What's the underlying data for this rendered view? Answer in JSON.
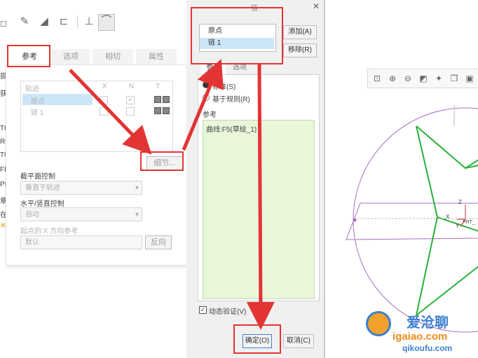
{
  "left_panel": {
    "tabs": [
      "参考",
      "选项",
      "相切",
      "属性"
    ],
    "table": {
      "headers": [
        "轨迹",
        "X",
        "N",
        "T"
      ],
      "rows": [
        {
          "name": "原点"
        },
        {
          "name": "链 1"
        }
      ]
    },
    "details_button": "细节...",
    "section_plane_label": "截平面控制",
    "section_plane_value": "垂直于轨迹",
    "hv_label": "水平/竖直控制",
    "hv_value": "自动",
    "xdir_label": "起点的 X 方向参考",
    "xdir_value": "默认",
    "reverse_button": "反向",
    "left_edge_chars": [
      "扱",
      "获",
      "T0",
      "R0",
      "T0",
      "FF",
      "PI",
      "章",
      "在",
      "※"
    ]
  },
  "chain_dialog": {
    "title_fragment": "链",
    "list_items": [
      "原点",
      "链 1"
    ],
    "add_button": "添加(A)",
    "remove_button": "移除(R)",
    "tabs": [
      "参考",
      "选项"
    ],
    "radio_standard": "标准(S)",
    "radio_rule": "基于规则(R)",
    "ref_label": "参考",
    "ref_value": "曲线:F5(草绘_1)",
    "dynamic_validate": "动态验证(V)",
    "ok_button": "确定(O)",
    "cancel_button": "取消(C)"
  },
  "model": {
    "csys_label": "PRT_",
    "axis_x": "X",
    "axis_y": "Y",
    "axis_z": "Z"
  },
  "watermark": {
    "line1": "爱沧聊",
    "url1": "igaiao.com",
    "url2": "qikoufu.com"
  },
  "colors": {
    "annotation_red": "#e23434",
    "curve_green": "#27b23a",
    "circle_purple": "#a66fc2",
    "selected_row": "#cde6f7"
  }
}
